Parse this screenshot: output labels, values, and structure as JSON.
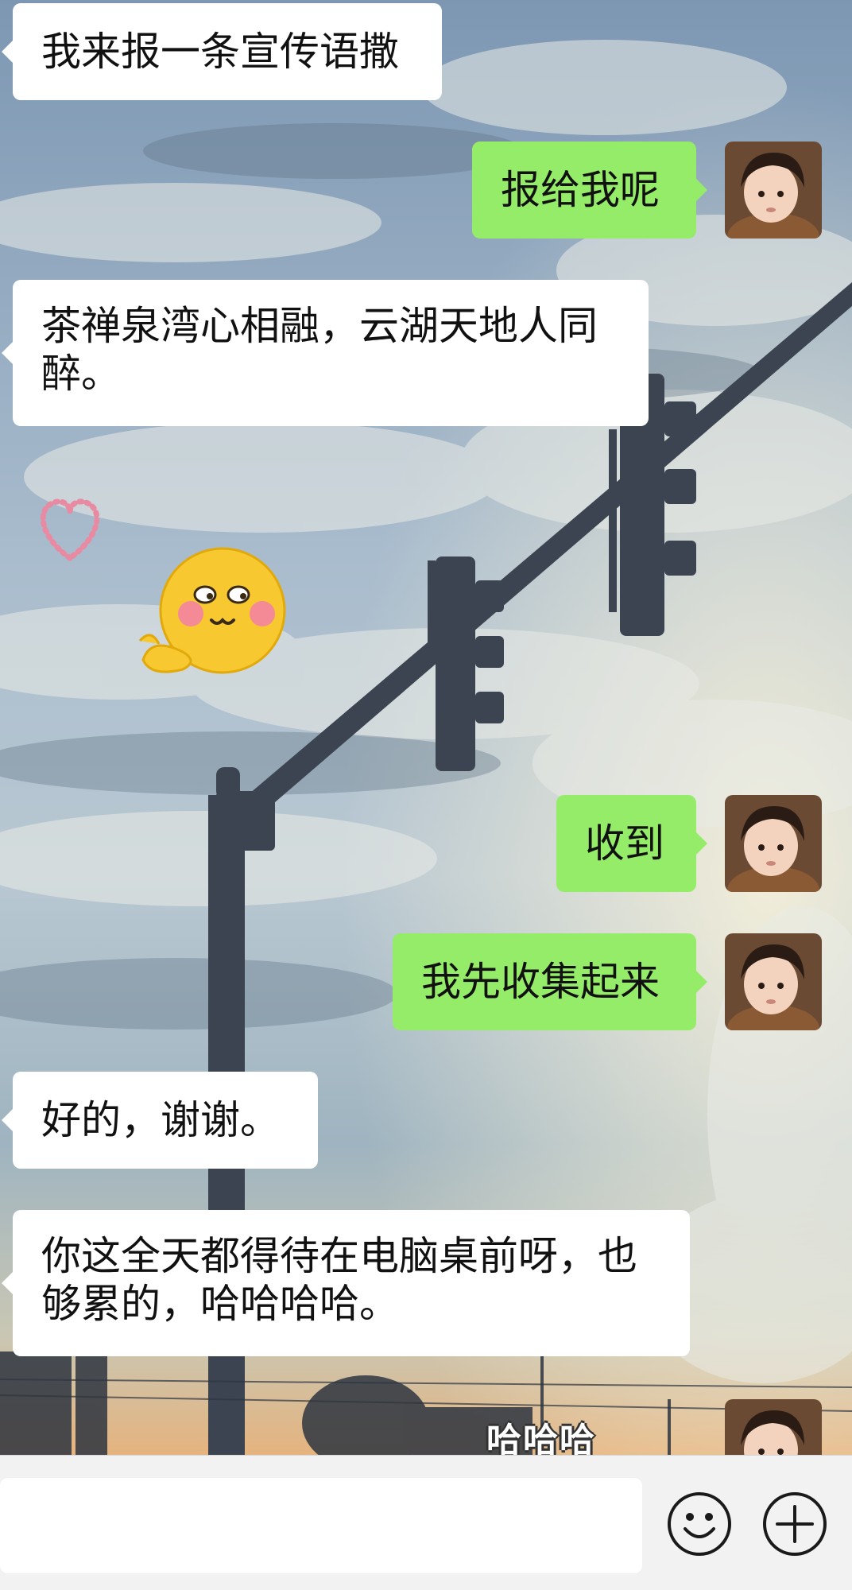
{
  "messages": [
    {
      "side": "in",
      "text_lines": [
        "我来报一条宣传语撒"
      ]
    },
    {
      "side": "out",
      "text_lines": [
        "报给我呢"
      ]
    },
    {
      "side": "in",
      "text_lines": [
        "茶禅泉湾心相融，云湖天地人同",
        "醉。"
      ]
    },
    {
      "side": "in",
      "type": "sticker",
      "sticker": "waving-emoji-with-heart"
    },
    {
      "side": "out",
      "text_lines": [
        "收到"
      ]
    },
    {
      "side": "out",
      "text_lines": [
        "我先收集起来"
      ]
    },
    {
      "side": "in",
      "text_lines": [
        "好的，谢谢。"
      ]
    },
    {
      "side": "in",
      "text_lines": [
        "你这全天都得待在电脑桌前呀，也",
        "够累的，哈哈哈哈。"
      ]
    },
    {
      "side": "out",
      "type": "sticker",
      "sticker_text": "哈哈哈"
    }
  ],
  "input_bar": {
    "text_value": "",
    "emoji_icon": "smiley-face-icon",
    "plus_icon": "plus-circle-icon"
  },
  "colors": {
    "incoming_bubble": "#ffffff",
    "outgoing_bubble": "#95ec69",
    "input_bar_bg": "#f2f2f2"
  }
}
